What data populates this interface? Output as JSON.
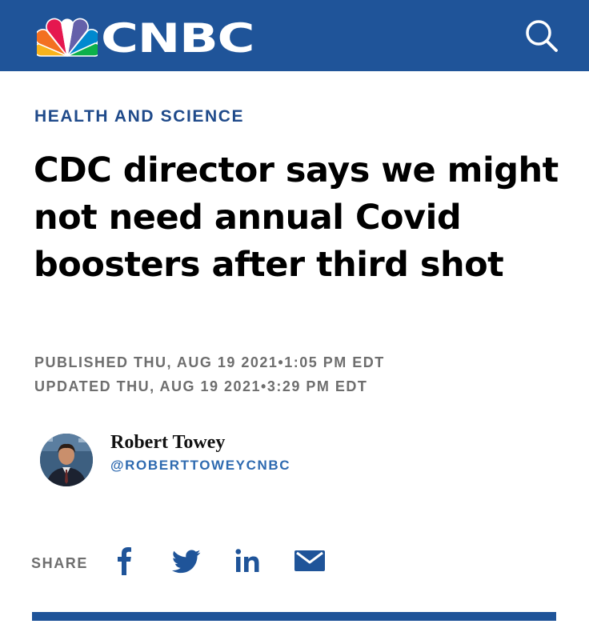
{
  "header": {
    "brand_name": "CNBC",
    "search_icon": "search-icon",
    "background_color": "#1f5499"
  },
  "article": {
    "section": "HEALTH AND SCIENCE",
    "headline": "CDC director says we might not need annual Covid boosters after third shot",
    "published": "PUBLISHED THU, AUG 19 2021•1:05 PM EDT",
    "updated": "UPDATED THU, AUG 19 2021•3:29 PM EDT"
  },
  "author": {
    "name": "Robert Towey",
    "handle": "@ROBERTTOWEYCNBC"
  },
  "share": {
    "label": "SHARE",
    "icons": [
      "facebook-icon",
      "twitter-icon",
      "linkedin-icon",
      "email-icon"
    ],
    "icon_color": "#1f5499"
  },
  "colors": {
    "brand_blue": "#1f5499",
    "section_blue": "#1f4a8a",
    "handle_blue": "#2e6ab0",
    "meta_gray": "#6e6e6e"
  }
}
